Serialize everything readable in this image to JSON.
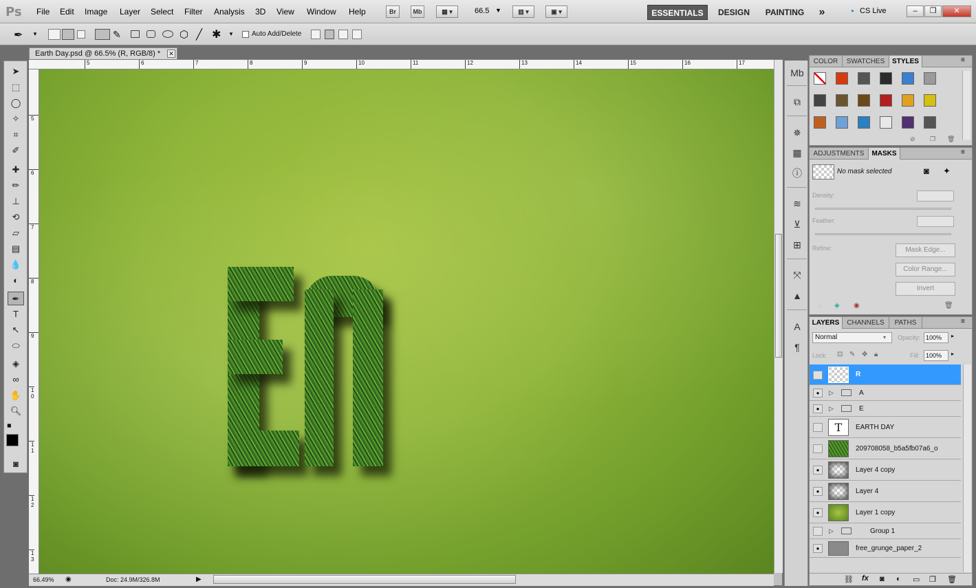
{
  "app": {
    "logo": "Ps"
  },
  "menu": [
    "File",
    "Edit",
    "Image",
    "Layer",
    "Select",
    "Filter",
    "Analysis",
    "3D",
    "View",
    "Window",
    "Help"
  ],
  "menubar_buttons": {
    "br": "Br",
    "mb": "Mb",
    "zoom": "66.5"
  },
  "workspaces": {
    "essentials": "ESSENTIALS",
    "design": "DESIGN",
    "painting": "PAINTING",
    "more": "»",
    "cslive": "CS Live"
  },
  "window_controls": {
    "minimize": "–",
    "restore": "❐",
    "close": "✕"
  },
  "options": {
    "auto_add_delete": "Auto Add/Delete"
  },
  "document": {
    "tab_title": "Earth Day.psd @ 66.5% (R, RGB/8) *",
    "zoom": "66.49%",
    "doc_size": "Doc: 24.9M/326.8M",
    "ruler_top": [
      "5",
      "6",
      "7",
      "8",
      "9",
      "10",
      "11",
      "12",
      "13",
      "14",
      "15",
      "16",
      "17"
    ],
    "ruler_left": [
      "5",
      "6",
      "7",
      "8",
      "9",
      "1 0",
      "1 1",
      "1 2",
      "1 3"
    ]
  },
  "swatch_panel": {
    "tabs": [
      "COLOR",
      "SWATCHES",
      "STYLES"
    ],
    "styles": [
      "#ffffff",
      "#d83a10",
      "#555555",
      "#2b2b2b",
      "#3a7fd0",
      "#9a9a9a",
      "#444444",
      "#6b5530",
      "#6b4a1a",
      "#b51f1f",
      "#e0a020",
      "#d4c010",
      "#c06020",
      "#70a0d8",
      "#2a80c0",
      "#e8e8e8",
      "#503070",
      "#555555"
    ]
  },
  "adjust_panel": {
    "tabs": [
      "ADJUSTMENTS",
      "MASKS"
    ],
    "no_mask": "No mask selected",
    "density": "Density:",
    "feather": "Feather:",
    "refine": "Refine:",
    "mask_edge": "Mask Edge...",
    "color_range": "Color Range...",
    "invert": "Invert"
  },
  "layers_panel": {
    "tabs": [
      "LAYERS",
      "CHANNELS",
      "PATHS"
    ],
    "blend_mode": "Normal",
    "opacity_label": "Opacity:",
    "opacity": "100%",
    "lock_label": "Lock:",
    "fill_label": "Fill:",
    "fill": "100%",
    "layers": [
      {
        "name": "R",
        "visible": false,
        "selected": true,
        "kind": "blank"
      },
      {
        "name": "A",
        "visible": true,
        "kind": "group"
      },
      {
        "name": "E",
        "visible": true,
        "kind": "group"
      },
      {
        "name": "EARTH DAY",
        "visible": false,
        "kind": "text",
        "glyph": "T"
      },
      {
        "name": "209708058_b5a5fb07a6_o",
        "visible": false,
        "kind": "grass"
      },
      {
        "name": "Layer 4 copy",
        "visible": true,
        "kind": "blur"
      },
      {
        "name": "Layer 4",
        "visible": true,
        "kind": "blur"
      },
      {
        "name": "Layer 1 copy",
        "visible": true,
        "kind": "green"
      },
      {
        "name": "Group 1",
        "visible": false,
        "kind": "group"
      },
      {
        "name": "free_grunge_paper_2",
        "visible": true,
        "kind": "gray"
      }
    ],
    "footer_icons": [
      "link-icon",
      "fx-icon",
      "mask-icon",
      "adjustment-icon",
      "folder-icon",
      "new-layer-icon",
      "trash-icon"
    ]
  },
  "colors": {
    "selection": "#3399ff",
    "canvas_green": "#8fb53a",
    "active_workspace": "#5a5a5a"
  }
}
